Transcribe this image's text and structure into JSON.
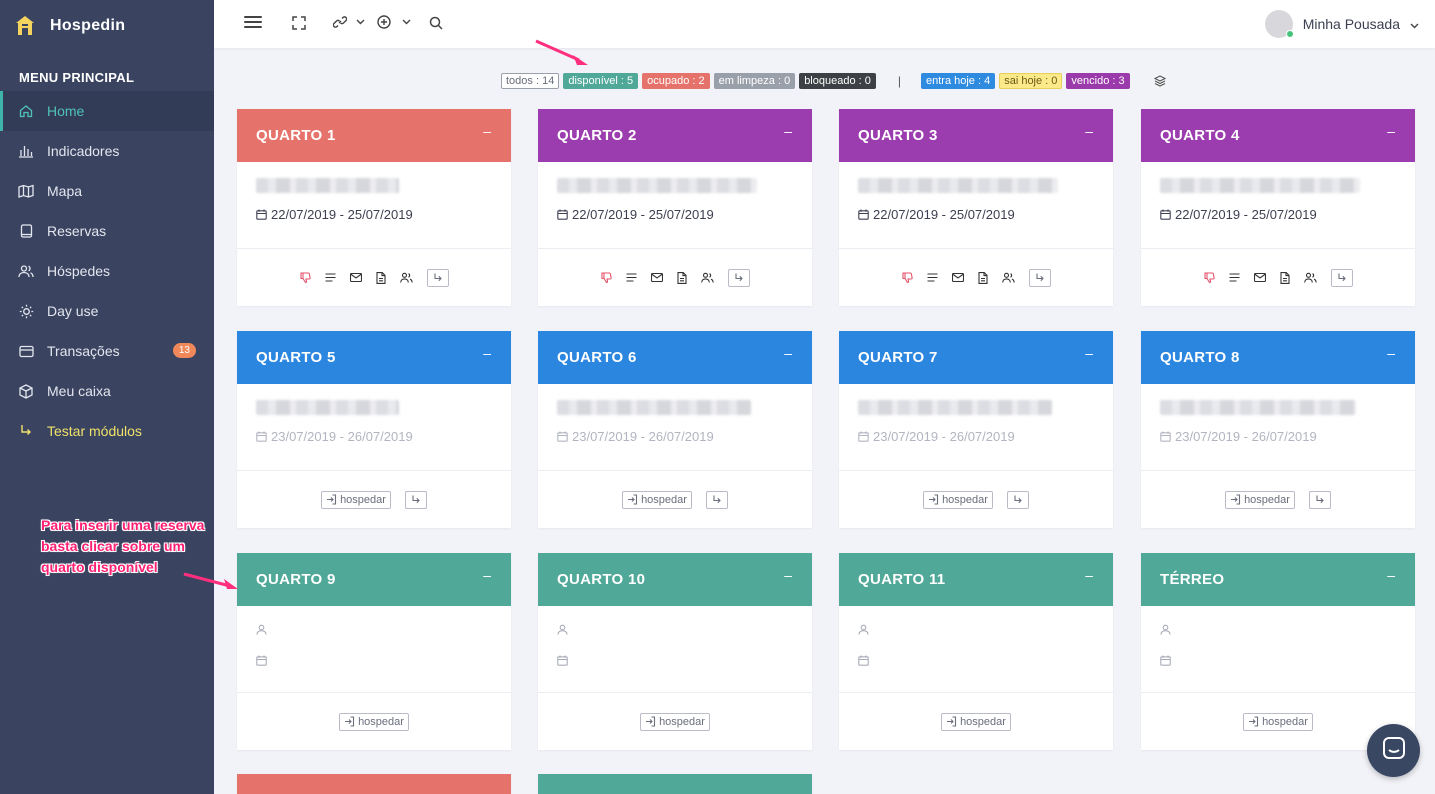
{
  "app": {
    "name": "Hospedin"
  },
  "sidebar": {
    "section_title": "MENU PRINCIPAL",
    "items": [
      {
        "label": "Home",
        "icon": "home-icon"
      },
      {
        "label": "Indicadores",
        "icon": "bar-chart-icon"
      },
      {
        "label": "Mapa",
        "icon": "map-icon"
      },
      {
        "label": "Reservas",
        "icon": "book-icon"
      },
      {
        "label": "Hóspedes",
        "icon": "users-icon"
      },
      {
        "label": "Day use",
        "icon": "sun-icon"
      },
      {
        "label": "Transações",
        "icon": "card-icon",
        "badge": "13"
      },
      {
        "label": "Meu caixa",
        "icon": "box-icon"
      },
      {
        "label": "Testar módulos",
        "icon": "arrow-turn-icon"
      }
    ]
  },
  "topbar": {
    "user_name": "Minha Pousada"
  },
  "filters": [
    {
      "label": "todos : 14",
      "style": "outline"
    },
    {
      "label": "disponível : 5",
      "color": "#4fa898"
    },
    {
      "label": "ocupado : 2",
      "color": "#e5736b"
    },
    {
      "label": "em limpeza : 0",
      "color": "#9aa0a9"
    },
    {
      "label": "bloqueado : 0",
      "color": "#3d4044"
    },
    {
      "label": "entra hoje : 4",
      "color": "#2f8be0"
    },
    {
      "label": "sai hoje : 0",
      "color": "#fbe98a",
      "text": "#6b5a14"
    },
    {
      "label": "vencido : 3",
      "color": "#9b3aaa"
    }
  ],
  "rooms": [
    {
      "name": "QUARTO 1",
      "status": "occupied",
      "color": "#e5736b",
      "dates": "22/07/2019 - 25/07/2019"
    },
    {
      "name": "QUARTO 2",
      "status": "overdue",
      "color": "#9b3dae",
      "dates": "22/07/2019 - 25/07/2019"
    },
    {
      "name": "QUARTO 3",
      "status": "overdue",
      "color": "#9b3dae",
      "dates": "22/07/2019 - 25/07/2019"
    },
    {
      "name": "QUARTO 4",
      "status": "overdue",
      "color": "#9b3dae",
      "dates": "22/07/2019 - 25/07/2019"
    },
    {
      "name": "QUARTO 5",
      "status": "arriving",
      "color": "#2b86e0",
      "dates": "23/07/2019 - 26/07/2019"
    },
    {
      "name": "QUARTO 6",
      "status": "arriving",
      "color": "#2b86e0",
      "dates": "23/07/2019 - 26/07/2019"
    },
    {
      "name": "QUARTO 7",
      "status": "arriving",
      "color": "#2b86e0",
      "dates": "23/07/2019 - 26/07/2019"
    },
    {
      "name": "QUARTO 8",
      "status": "arriving",
      "color": "#2b86e0",
      "dates": "23/07/2019 - 26/07/2019"
    },
    {
      "name": "QUARTO 9",
      "status": "available",
      "color": "#4fa898",
      "dates": ""
    },
    {
      "name": "QUARTO 10",
      "status": "available",
      "color": "#4fa898",
      "dates": ""
    },
    {
      "name": "QUARTO 11",
      "status": "available",
      "color": "#4fa898",
      "dates": ""
    },
    {
      "name": "TÉRREO",
      "status": "available",
      "color": "#4fa898",
      "dates": ""
    },
    {
      "name": "",
      "status": "occupied",
      "color": "#e5736b",
      "dates": ""
    },
    {
      "name": "",
      "status": "available",
      "color": "#4fa898",
      "dates": ""
    }
  ],
  "labels": {
    "checkin": "hospedar",
    "collapse": "–"
  },
  "annotation": "Para inserir uma reserva basta clicar sobre um quarto disponível"
}
